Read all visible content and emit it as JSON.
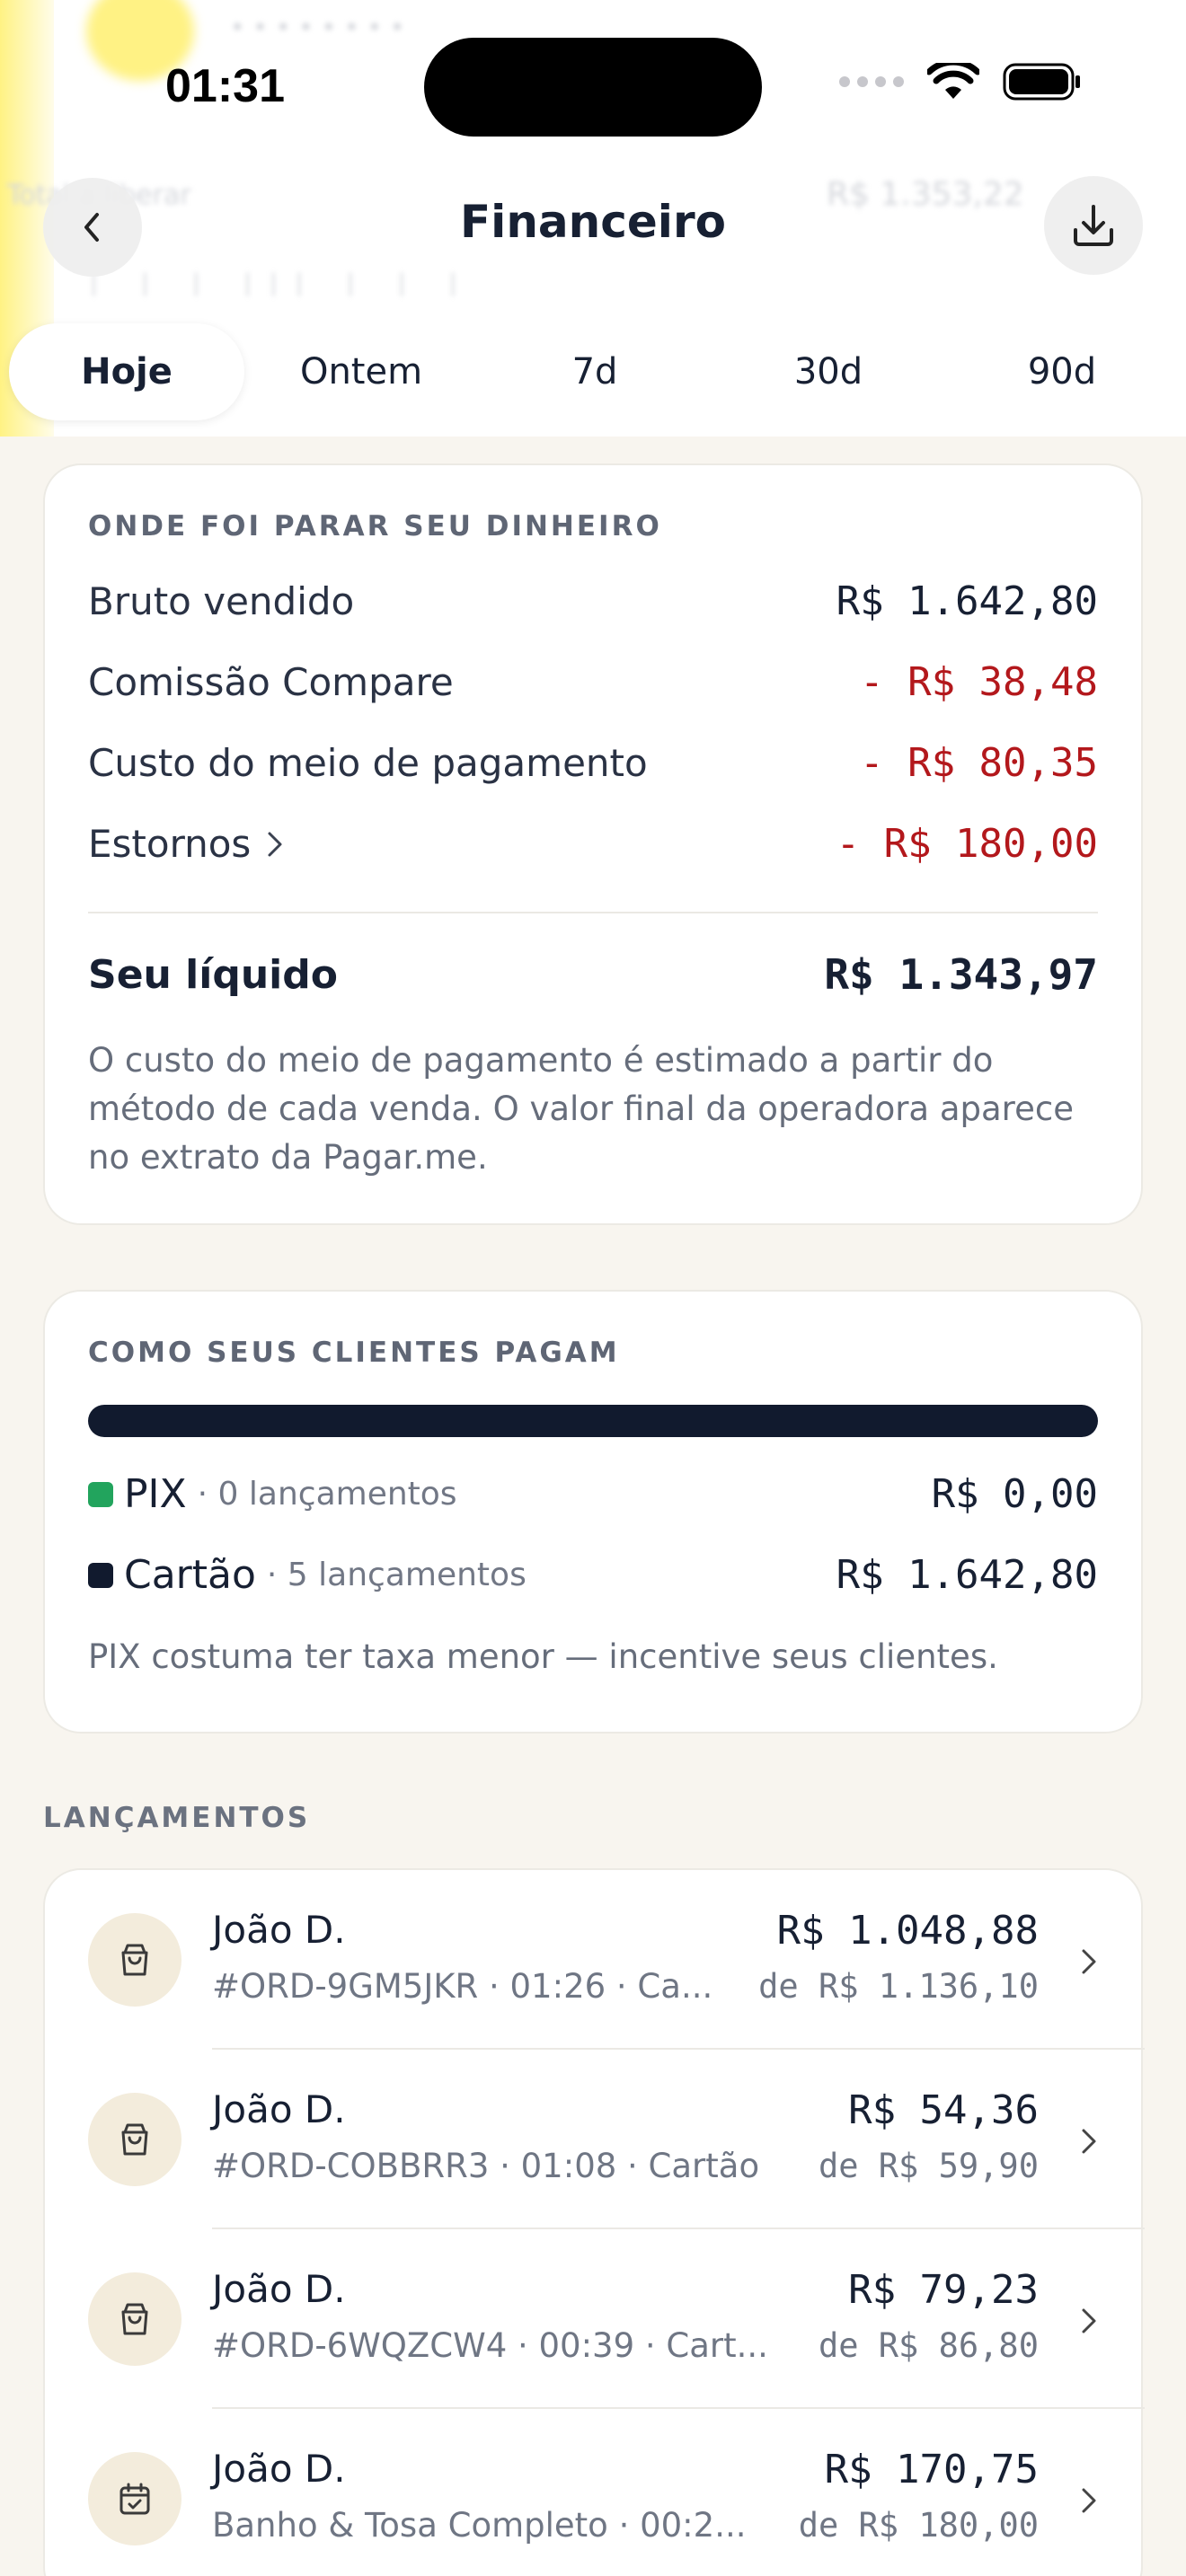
{
  "status_bar": {
    "time": "01:31"
  },
  "header": {
    "title": "Financeiro"
  },
  "tabs": [
    {
      "label": "Hoje",
      "active": true
    },
    {
      "label": "Ontem",
      "active": false
    },
    {
      "label": "7d",
      "active": false
    },
    {
      "label": "30d",
      "active": false
    },
    {
      "label": "90d",
      "active": false
    }
  ],
  "breakdown": {
    "section_label": "ONDE FOI PARAR SEU DINHEIRO",
    "rows": [
      {
        "label": "Bruto vendido",
        "value": "R$ 1.642,80"
      },
      {
        "label": "Comissão Compare",
        "value": "- R$ 38,48"
      },
      {
        "label": "Custo do meio de pagamento",
        "value": "- R$ 80,35"
      },
      {
        "label": "Estornos",
        "value": "- R$ 180,00"
      }
    ],
    "net_label": "Seu líquido",
    "net_value": "R$ 1.343,97",
    "note": "O custo do meio de pagamento é estimado a partir do método de cada venda. O valor final da operadora aparece no extrato da Pagar.me."
  },
  "payments": {
    "section_label": "COMO SEUS CLIENTES PAGAM",
    "pix_share": 0.0,
    "methods": [
      {
        "name": "PIX",
        "count": "· 0 lançamentos",
        "value": "R$ 0,00",
        "color": "#22a45d"
      },
      {
        "name": "Cartão",
        "count": "· 5 lançamentos",
        "value": "R$ 1.642,80",
        "color": "#111a2e"
      }
    ],
    "note": "PIX costuma ter taxa menor — incentive seus clientes."
  },
  "transactions": {
    "section_label": "LANÇAMENTOS",
    "items": [
      {
        "icon": "shopping-bag-icon",
        "name": "João D.",
        "sub": "#ORD-9GM5JKR · 01:26 · Ca...",
        "amount": "R$ 1.048,88",
        "from": "de R$ 1.136,10"
      },
      {
        "icon": "shopping-bag-icon",
        "name": "João D.",
        "sub": "#ORD-COBBRR3 · 01:08 · Cartão",
        "amount": "R$ 54,36",
        "from": "de R$ 59,90"
      },
      {
        "icon": "shopping-bag-icon",
        "name": "João D.",
        "sub": "#ORD-6WQZCW4 · 00:39 · Cart...",
        "amount": "R$ 79,23",
        "from": "de R$ 86,80"
      },
      {
        "icon": "calendar-check-icon",
        "name": "João D.",
        "sub": "Banho & Tosa Completo · 00:2...",
        "amount": "R$ 170,75",
        "from": "de R$ 180,00"
      }
    ]
  }
}
